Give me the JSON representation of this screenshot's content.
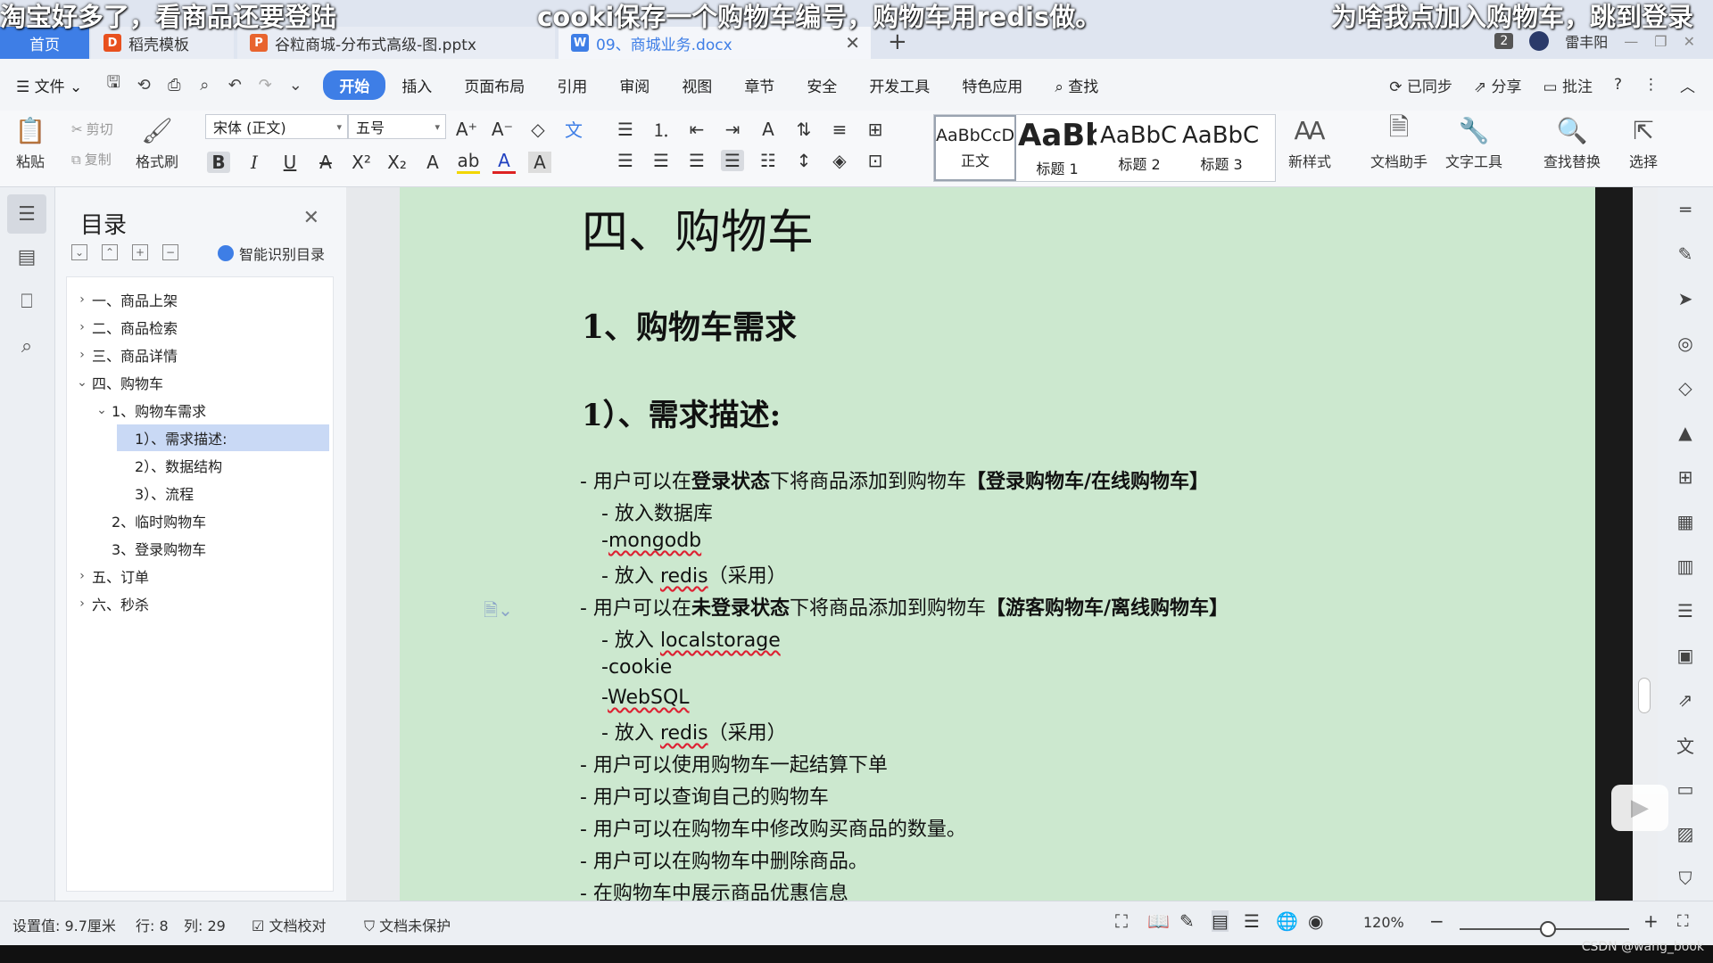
{
  "subtitles": {
    "left": "淘宝好多了，看商品还要登陆",
    "center": "cooki保存一个购物车编号，购物车用redis做。",
    "right": "为啥我点加入购物车，跳到登录"
  },
  "tabs": {
    "home": "首页",
    "template": "稻壳模板",
    "ppt": "谷粒商城-分布式高级-图.pptx",
    "doc": "09、商城业务.docx",
    "badge": "2",
    "user": "雷丰阳"
  },
  "menu": {
    "file": "文件",
    "items": [
      "开始",
      "插入",
      "页面布局",
      "引用",
      "审阅",
      "视图",
      "章节",
      "安全",
      "开发工具",
      "特色应用"
    ],
    "search": "查找",
    "synced": "已同步",
    "share": "分享",
    "comment": "批注"
  },
  "ribbon": {
    "paste": "粘贴",
    "cut": "剪切",
    "copy": "复制",
    "format_painter": "格式刷",
    "font_name": "宋体 (正文)",
    "font_size": "五号",
    "styles": [
      {
        "preview": "AaBbCcDd",
        "name": "正文"
      },
      {
        "preview": "AaBb",
        "name": "标题 1"
      },
      {
        "preview": "AaBbC(",
        "name": "标题 2"
      },
      {
        "preview": "AaBbC(",
        "name": "标题 3"
      }
    ],
    "new_style": "新样式",
    "doc_helper": "文档助手",
    "text_tools": "文字工具",
    "find_replace": "查找替换",
    "select": "选择"
  },
  "toc": {
    "title": "目录",
    "smart": "智能识别目录",
    "items": [
      "一、商品上架",
      "二、商品检索",
      "三、商品详情",
      "四、购物车",
      "1、购物车需求",
      "1）、需求描述:",
      "2）、数据结构",
      "3）、流程",
      "2、临时购物车",
      "3、登录购物车",
      "五、订单",
      "六、秒杀"
    ]
  },
  "doc": {
    "h1": "四、购物车",
    "h2": "1、购物车需求",
    "h3": "1）、需求描述:",
    "l1_pre": "- 用户可以在",
    "l1_b1": "登录状态",
    "l1_mid": "下将商品添加到购物车",
    "l1_b2": "【登录购物车/在线购物车】",
    "l2": "- 放入数据库",
    "l3_pre": "-",
    "l3_sq": "mongodb",
    "l4_pre": "- 放入 ",
    "l4_sq": "redis",
    "l4_post": "（采用）",
    "l5_pre": "- 用户可以在",
    "l5_b1": "未登录状态",
    "l5_mid": "下将商品添加到购物车",
    "l5_b2": "【游客购物车/离线购物车】",
    "l6_pre": "- 放入 ",
    "l6_sq": "localstorage",
    "l7": "-cookie",
    "l8_pre": "-",
    "l8_sq": "WebSQL",
    "l9_pre": "- 放入 ",
    "l9_sq": "redis",
    "l9_post": "（采用）",
    "l10": "- 用户可以使用购物车一起结算下单",
    "l11": "- 用户可以查询自己的购物车",
    "l12": "- 用户可以在购物车中修改购买商品的数量。",
    "l13": "- 用户可以在购物车中删除商品。",
    "l14": "- 在购物车中展示商品优惠信息"
  },
  "status": {
    "setting": "设置值: 9.7厘米",
    "row": "行: 8",
    "col": "列: 29",
    "proof": "文档校对",
    "protect": "文档未保护",
    "zoom": "120%"
  },
  "watermark": "CSDN @wang_book"
}
